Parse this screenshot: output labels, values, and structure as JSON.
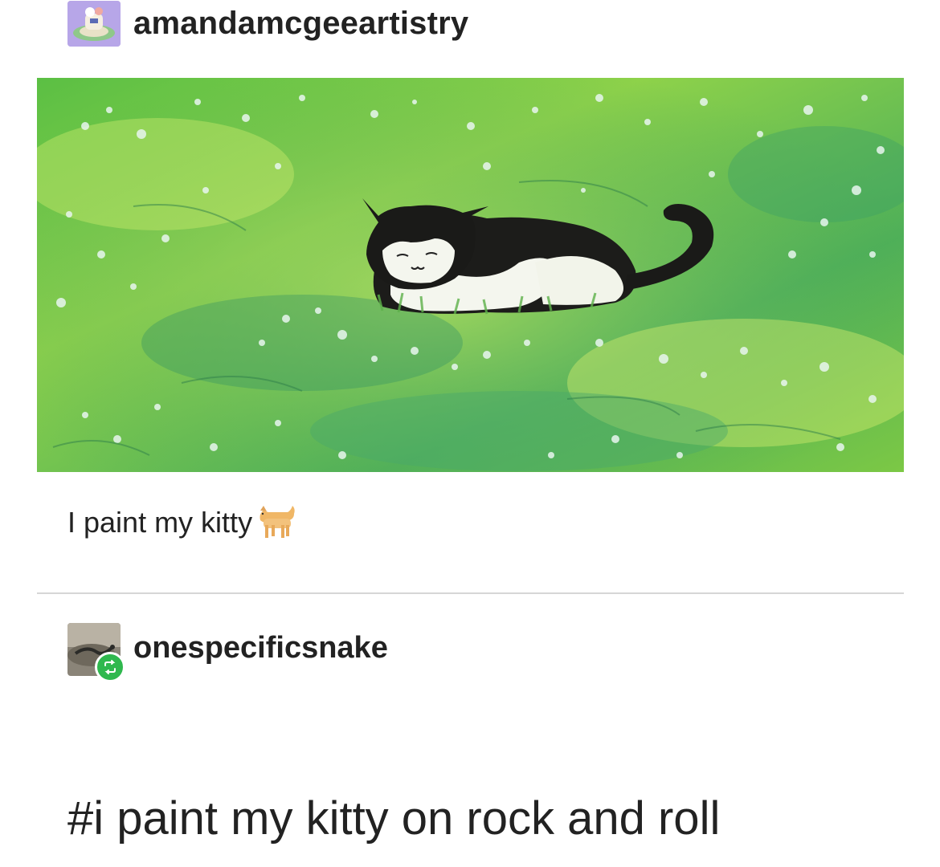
{
  "original_post": {
    "username": "amandamcgeeartistry",
    "avatar": {
      "icon": "lighthouse-avatar-icon",
      "background": "#b7a6e8"
    },
    "image": {
      "subject": "painting-black-white-cat-lying-in-green-grass",
      "accent": "#7fc843"
    },
    "caption": "I paint my kitty",
    "caption_emoji": "cat-emoji"
  },
  "reblog": {
    "username": "onespecificsnake",
    "avatar_icon": "snake-avatar-icon",
    "badge_icon": "reblog-icon",
    "badge_color": "#2fb84e",
    "tags": "#i paint my kitty on rock and roll"
  }
}
